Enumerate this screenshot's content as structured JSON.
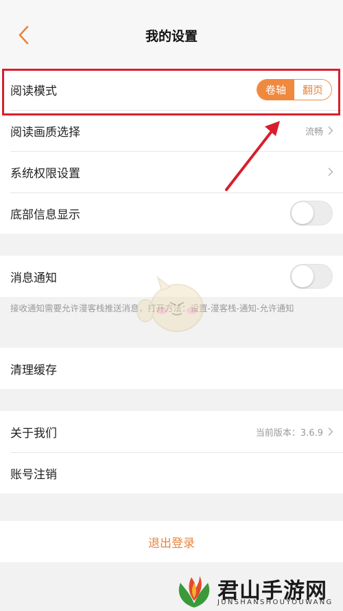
{
  "nav": {
    "title": "我的设置"
  },
  "reading": {
    "rows": [
      {
        "label": "阅读模式",
        "options": [
          "卷轴",
          "翻页"
        ],
        "selected": "卷轴"
      },
      {
        "label": "阅读画质选择",
        "value": "流畅"
      },
      {
        "label": "系统权限设置"
      },
      {
        "label": "底部信息显示",
        "toggle": false
      }
    ]
  },
  "notify": {
    "label": "消息通知",
    "toggle": false,
    "hint": "接收通知需要允许漫客栈推送消息，打开方法：设置-漫客栈-通知-允许通知"
  },
  "cache": {
    "label": "清理缓存"
  },
  "about": {
    "label": "关于我们",
    "value": "当前版本：3.6.9",
    "account_label": "账号注销"
  },
  "logout": {
    "label": "退出登录"
  },
  "watermark": {
    "main": "君山手游网",
    "sub": "JUNSHANSHOUYOUWANG"
  },
  "colors": {
    "accent": "#f0883e",
    "highlight": "#d81e2c",
    "background": "#f2f2f2"
  }
}
